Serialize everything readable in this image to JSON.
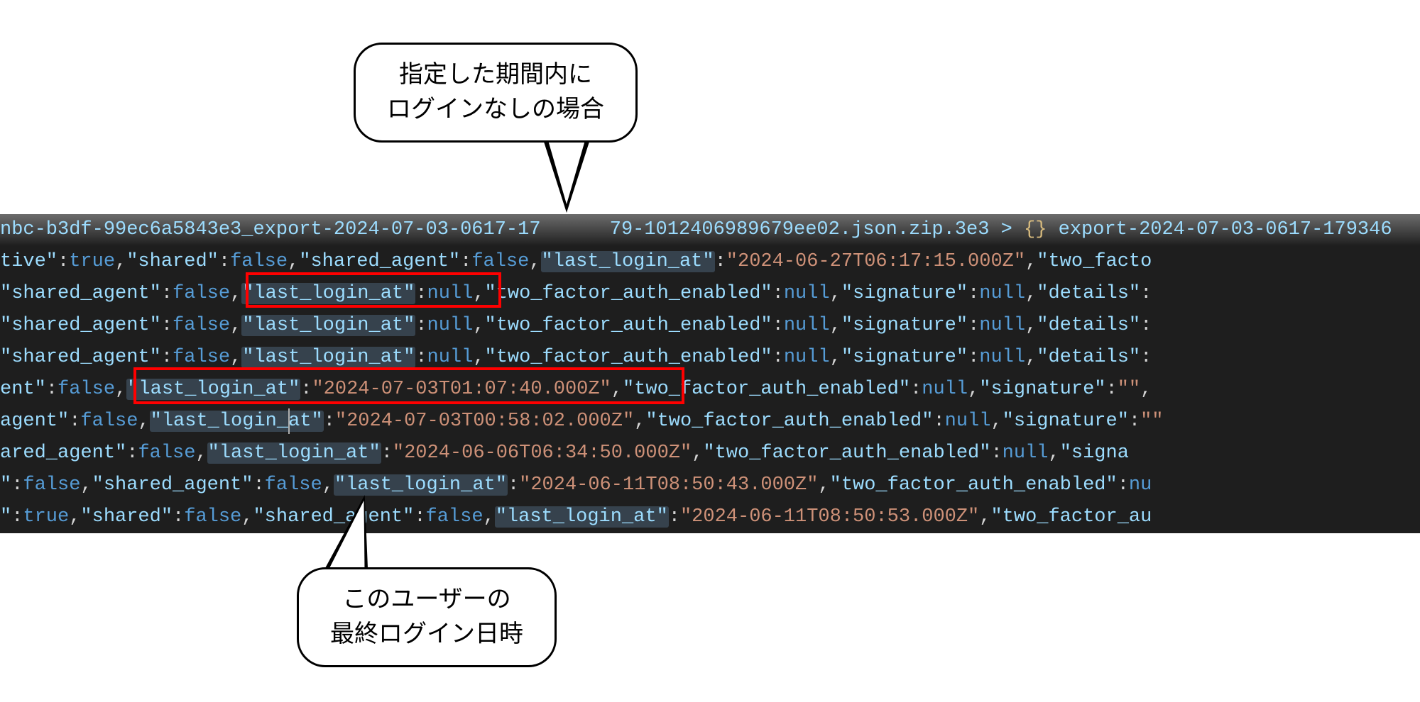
{
  "callouts": {
    "top_line1": "指定した期間内に",
    "top_line2": "ログインなしの場合",
    "bottom_line1": "このユーザーの",
    "bottom_line2": "最終ログイン日時"
  },
  "code": {
    "tab_text_left": "nbc-b3df-99ec6a5843e3_export-2024-07-03-0617-17",
    "tab_text_mid": "79-1012406989679ee02.json.zip.3e3 > ",
    "tab_text_right": " export-2024-07-03-0617-179346",
    "tokens": {
      "true": "true",
      "false": "false",
      "null": "null",
      "shared": "\"shared\"",
      "shared_agent": "\"shared_agent\"",
      "last_login_at": "\"last_login_at\"",
      "two_factor_auth_enabled": "\"two_factor_auth_enabled\"",
      "signature": "\"signature\"",
      "details": "\"details\"",
      "two_facto": "\"two_facto",
      "two_factor_au": "\"two_factor_au",
      "signa": "\"signa",
      "empty_str": "\"\""
    },
    "values": {
      "v1": "\"2024-06-27T06:17:15.000Z\"",
      "v2": "\"2024-07-03T01:07:40.000Z\"",
      "v3": "\"2024-07-03T00:58:02.000Z\"",
      "v4": "\"2024-06-06T06:34:50.000Z\"",
      "v5": "\"2024-06-11T08:50:43.000Z\"",
      "v6": "\"2024-06-11T08:50:53.000Z\""
    },
    "prefixes": {
      "l1": "tive\"",
      "l2": "\"shared_agent\"",
      "l3": "\"shared_agent\"",
      "l4": "\"shared_agent\"",
      "l5": "ent\"",
      "l6": "agent\"",
      "l7": "ared_agent\"",
      "l8": "\"",
      "l9": "\""
    }
  }
}
